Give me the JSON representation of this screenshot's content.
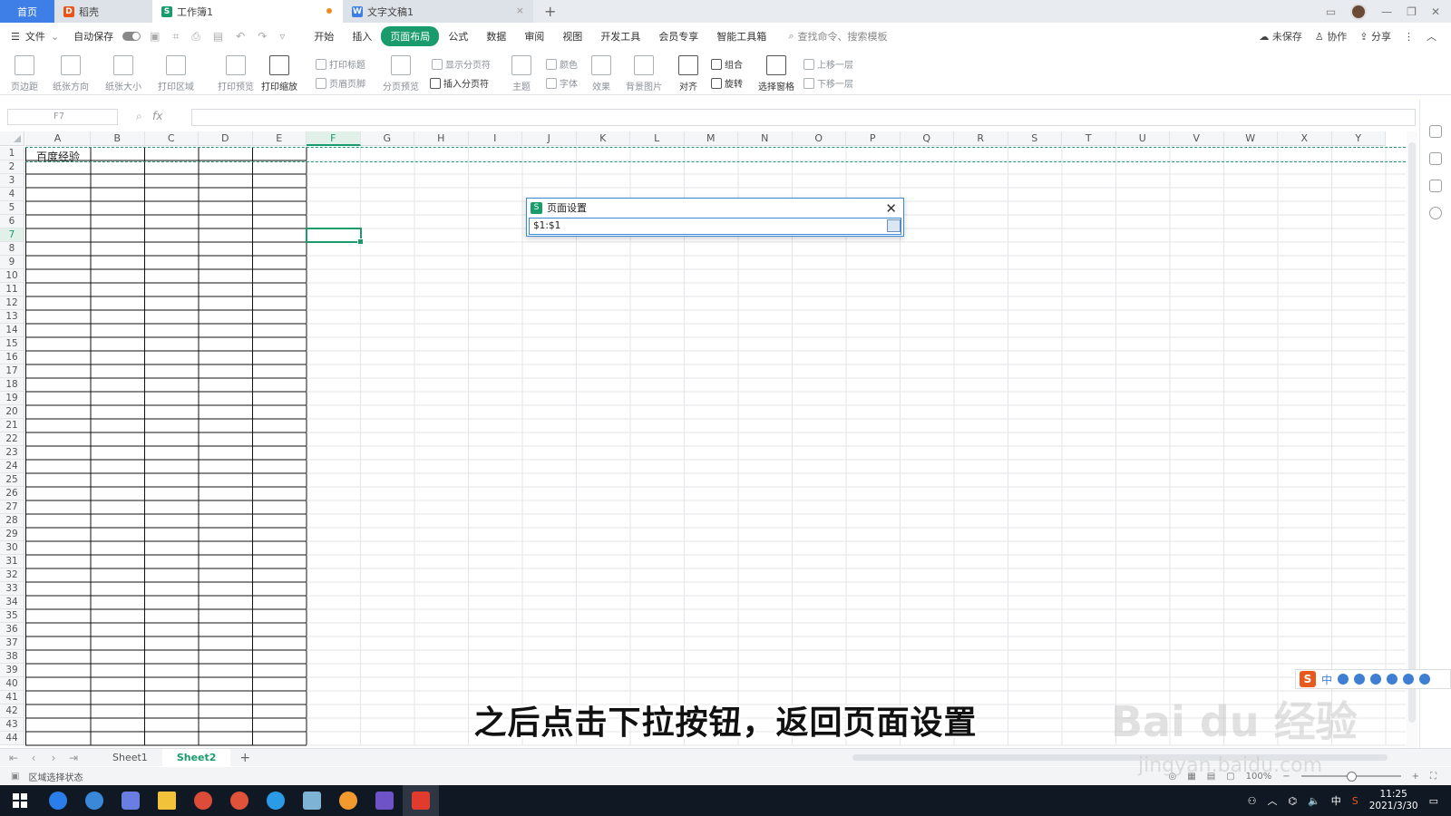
{
  "tabs": {
    "home": "首页",
    "daoke": "稻壳",
    "workbook": "工作簿1",
    "doc": "文字文稿1",
    "add": "+"
  },
  "menu": {
    "file": "文件",
    "autosave": "自动保存",
    "tabs": [
      "开始",
      "插入",
      "页面布局",
      "公式",
      "数据",
      "审阅",
      "视图",
      "开发工具",
      "会员专享",
      "智能工具箱"
    ],
    "active_tab_index": 2,
    "search": "查找命令、搜索模板",
    "unsaved": "未保存",
    "collab": "协作",
    "share": "分享"
  },
  "ribbon": {
    "margins": "页边距",
    "orientation": "纸张方向",
    "size": "纸张大小",
    "print_area": "打印区域",
    "print_preview": "打印预览",
    "print_scale": "打印缩放",
    "print_titles": "打印标题",
    "header_footer": "页眉页脚",
    "page_break_preview": "分页预览",
    "show_page_breaks": "显示分页符",
    "insert_page_break": "插入分页符",
    "theme": "主题",
    "colors": "颜色",
    "fonts": "字体",
    "effects": "效果",
    "background": "背景图片",
    "align": "对齐",
    "group": "组合",
    "rotate": "旋转",
    "selection_pane": "选择窗格",
    "bring_forward": "上移一层",
    "send_backward": "下移一层"
  },
  "formula_bar": {
    "cell_ref": "F7",
    "fx": "fx",
    "value": ""
  },
  "grid": {
    "columns": [
      "A",
      "B",
      "C",
      "D",
      "E",
      "F",
      "G",
      "H",
      "I",
      "J",
      "K",
      "L",
      "M",
      "N",
      "O",
      "P",
      "Q",
      "R",
      "S",
      "T",
      "U",
      "V",
      "W",
      "X",
      "Y"
    ],
    "rows": 44,
    "selected_col": "F",
    "selected_row": 7,
    "cell_a1": "百度经验"
  },
  "dialog": {
    "title": "页面设置",
    "input_value": "$1:$1",
    "icon": "S"
  },
  "sheets": {
    "items": [
      "Sheet1",
      "Sheet2"
    ],
    "active": "Sheet2",
    "add": "+"
  },
  "status": {
    "mode": "区域选择状态",
    "zoom": "100%"
  },
  "subtitle": "之后点击下拉按钮，返回页面设置",
  "watermark": {
    "main": "Bai du 经验",
    "sub": "jingyan.baidu.com"
  },
  "ime": {
    "lang": "中"
  },
  "taskbar": {
    "time": "11:25",
    "date": "2021/3/30",
    "lang": "中"
  },
  "colors": {
    "accent": "#1a9b6c",
    "home_tab": "#3d7fe6",
    "dialog_border": "#3a8ad6"
  }
}
